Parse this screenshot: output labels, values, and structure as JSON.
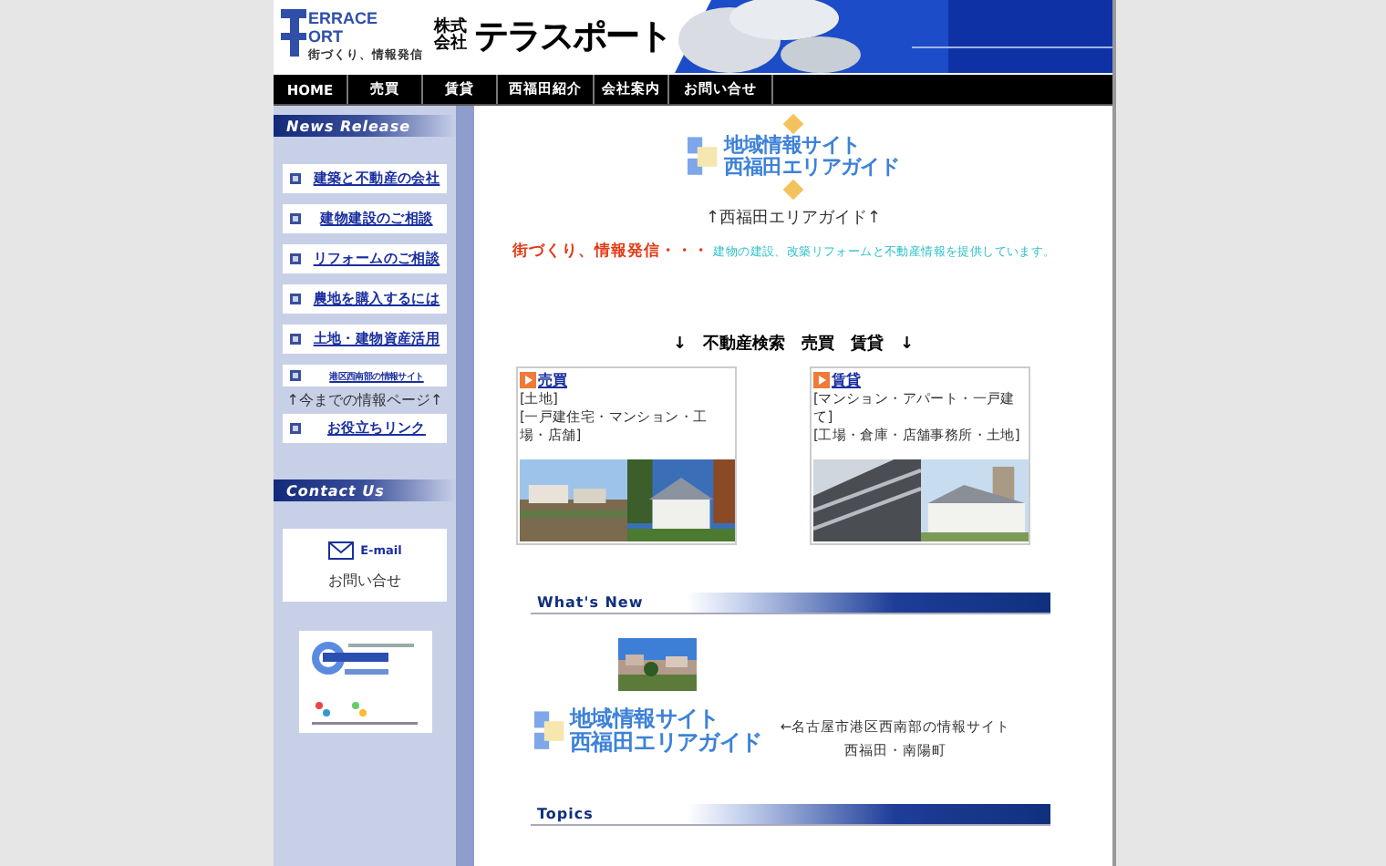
{
  "header": {
    "logo": {
      "mark_top": "ERRACE",
      "mark_bottom": "ORT",
      "tagline": "街づくり、情報発信"
    },
    "company": {
      "prefix_top": "株式",
      "prefix_bottom": "会社",
      "name": "テラスポート"
    }
  },
  "nav": [
    "HOME",
    "売買",
    "賃貸",
    "西福田紹介",
    "会社案内",
    "お問い合せ"
  ],
  "sidebar": {
    "news_heading": "News Release",
    "news_items": [
      {
        "label": "建築と不動産の会社",
        "kind": "link"
      },
      {
        "label": "建物建設のご相談",
        "kind": "link"
      },
      {
        "label": "リフォームのご相談",
        "kind": "link"
      },
      {
        "label": "農地を購入するには",
        "kind": "link"
      },
      {
        "label": "土地・建物資産活用",
        "kind": "link"
      },
      {
        "label": "港区西南部の情報サイト",
        "kind": "small-link"
      },
      {
        "label": "↑今までの情報ページ↑",
        "kind": "note"
      },
      {
        "label": "お役立ちリンク",
        "kind": "link"
      }
    ],
    "contact_heading": "Contact Us",
    "email": {
      "label": "E-mail",
      "caption": "お問い合せ"
    }
  },
  "main": {
    "site_logo": {
      "line1": "地域情報サイト",
      "line2": "西福田エリアガイド"
    },
    "logo_caption": "↑西福田エリアガイド↑",
    "slogan": "街づくり、情報発信・・・",
    "description": "建物の建設、改築リフォームと不動産情報を提供しています。",
    "search_heading": "↓　不動産検索　売買　賃貸　↓",
    "listings": [
      {
        "title": "売買",
        "lines": [
          "[土地]",
          "[一戸建住宅・マンション・工場・店舗]"
        ]
      },
      {
        "title": "賃貸",
        "lines": [
          "[マンション・アパート・一戸建て]",
          "[工場・倉庫・店舗事務所・土地]"
        ]
      }
    ],
    "whats_new": {
      "heading": "What's New",
      "logo": {
        "line1": "地域情報サイト",
        "line2": "西福田エリアガイド"
      },
      "caption_lines": [
        "←名古屋市港区西南部の情報サイト",
        "西福田・南陽町"
      ]
    },
    "topics_heading": "Topics"
  }
}
